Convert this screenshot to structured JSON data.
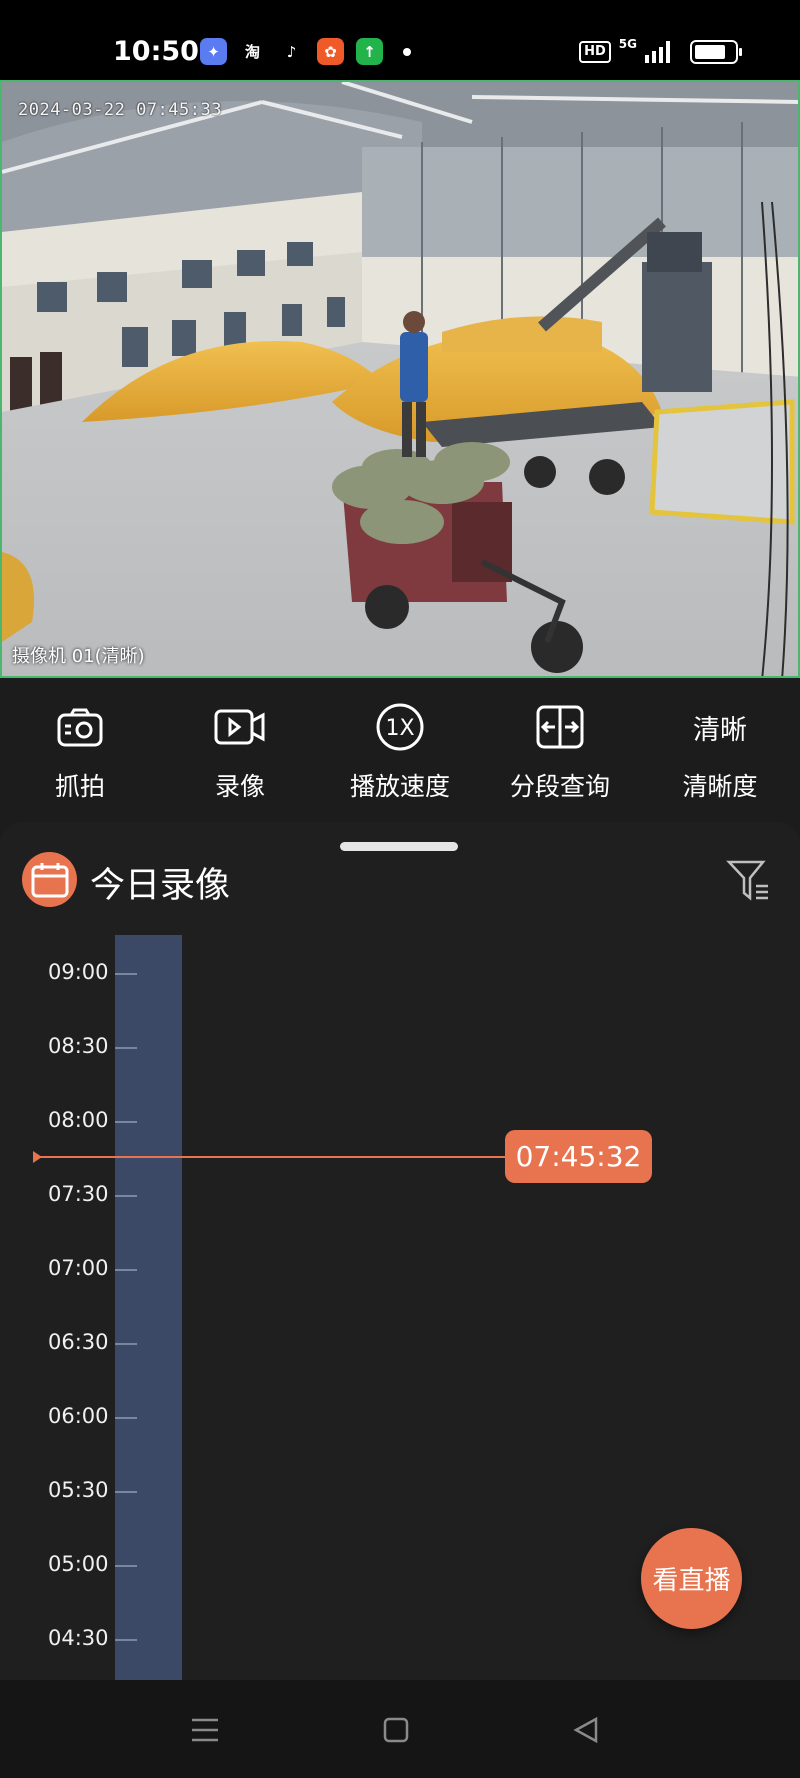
{
  "status_bar": {
    "time": "10:50",
    "apps": [
      {
        "name": "bird-app",
        "color": "#5a7cf0",
        "glyph": "✦"
      },
      {
        "name": "taobao",
        "color": "#000000",
        "glyph": "淘"
      },
      {
        "name": "tiktok",
        "color": "#000000",
        "glyph": "♪"
      },
      {
        "name": "app-orange",
        "color": "#f05a28",
        "glyph": "✿"
      },
      {
        "name": "app-green",
        "color": "#22b34a",
        "glyph": "↑"
      }
    ],
    "hd_label": "HD",
    "network_label": "5G"
  },
  "video": {
    "timestamp_overlay": "2024-03-22 07:45:33",
    "camera_label": "摄像机 01(清晰)"
  },
  "toolbar": {
    "items": [
      {
        "icon": "camera-snapshot-icon",
        "label": "抓拍"
      },
      {
        "icon": "video-record-icon",
        "label": "录像"
      },
      {
        "icon": "playback-speed-icon",
        "icon_text": "1X",
        "label": "播放速度"
      },
      {
        "icon": "segment-query-icon",
        "label": "分段查询"
      },
      {
        "icon": "clarity-text",
        "icon_text": "清晰",
        "label": "清晰度"
      }
    ]
  },
  "recordings": {
    "title": "今日录像",
    "filter_icon": "filter-icon",
    "calendar_icon": "calendar-icon",
    "time_labels": [
      "09:00",
      "08:30",
      "08:00",
      "07:30",
      "07:00",
      "06:30",
      "06:00",
      "05:30",
      "05:00",
      "04:30"
    ],
    "current_time": "07:45:32",
    "accent_color": "#e8744f",
    "recording_bar_color": "#3b4866"
  },
  "live_button": {
    "label": "看直播"
  },
  "nav": {
    "menu_icon": "menu-icon",
    "home_icon": "home-icon",
    "back_icon": "back-icon"
  }
}
